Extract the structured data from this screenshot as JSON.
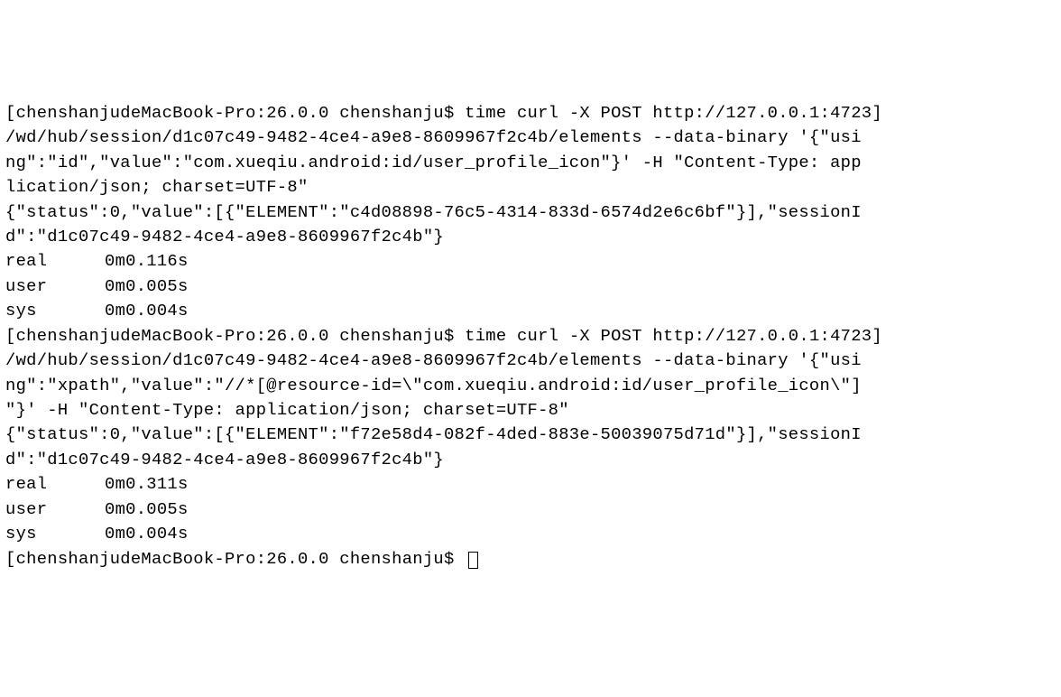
{
  "terminal": {
    "open_bracket": "[",
    "close_bracket": "]",
    "prompt_host": "chenshanjudeMacBook-Pro:26.0.0 chenshanju$",
    "cmd1": {
      "line1": " time curl -X POST http://127.0.0.1:4723",
      "line2": "/wd/hub/session/d1c07c49-9482-4ce4-a9e8-8609967f2c4b/elements --data-binary '{\"usi",
      "line3": "ng\":\"id\",\"value\":\"com.xueqiu.android:id/user_profile_icon\"}' -H \"Content-Type: app",
      "line4": "lication/json; charset=UTF-8\""
    },
    "resp1": {
      "line1": "{\"status\":0,\"value\":[{\"ELEMENT\":\"c4d08898-76c5-4314-833d-6574d2e6c6bf\"}],\"sessionI",
      "line2": "d\":\"d1c07c49-9482-4ce4-a9e8-8609967f2c4b\"}"
    },
    "timing1": {
      "real_label": "real",
      "real_value": "0m0.116s",
      "user_label": "user",
      "user_value": "0m0.005s",
      "sys_label": "sys",
      "sys_value": "0m0.004s"
    },
    "cmd2": {
      "line1": " time curl -X POST http://127.0.0.1:4723",
      "line2": "/wd/hub/session/d1c07c49-9482-4ce4-a9e8-8609967f2c4b/elements --data-binary '{\"usi",
      "line3": "ng\":\"xpath\",\"value\":\"//*[@resource-id=\\\"com.xueqiu.android:id/user_profile_icon\\\"]",
      "line4": "\"}' -H \"Content-Type: application/json; charset=UTF-8\""
    },
    "resp2": {
      "line1": "{\"status\":0,\"value\":[{\"ELEMENT\":\"f72e58d4-082f-4ded-883e-50039075d71d\"}],\"sessionI",
      "line2": "d\":\"d1c07c49-9482-4ce4-a9e8-8609967f2c4b\"}"
    },
    "timing2": {
      "real_label": "real",
      "real_value": "0m0.311s",
      "user_label": "user",
      "user_value": "0m0.005s",
      "sys_label": "sys",
      "sys_value": "0m0.004s"
    }
  }
}
